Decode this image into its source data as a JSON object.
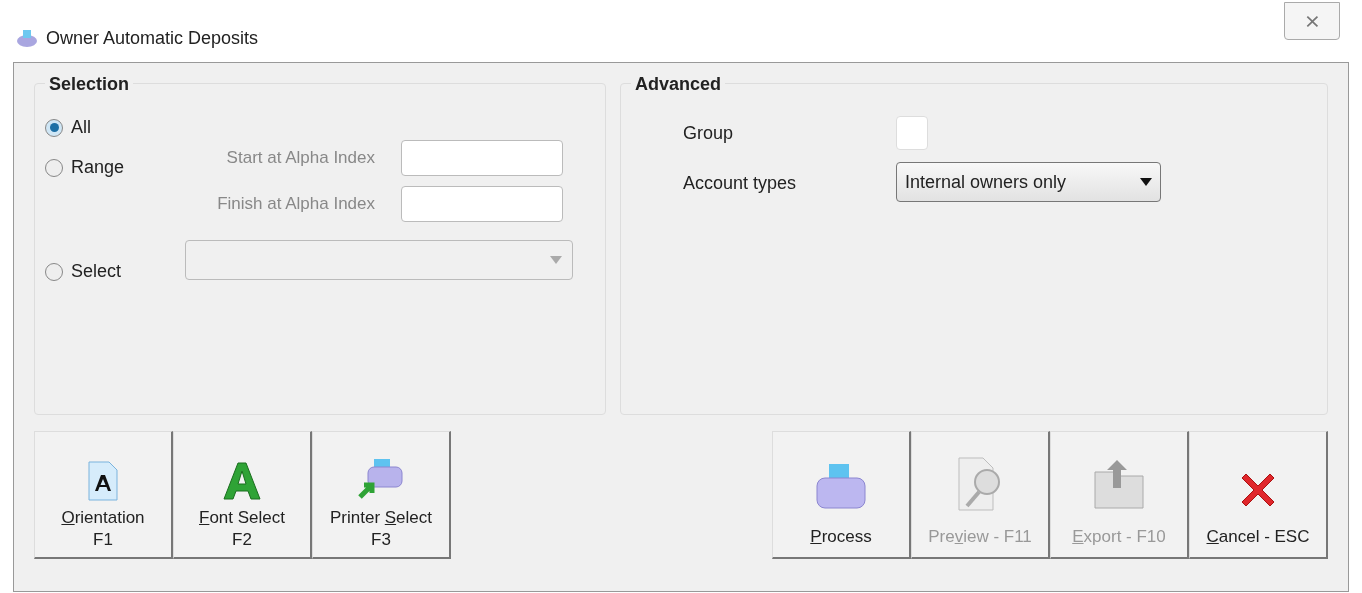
{
  "window": {
    "title": "Owner Automatic Deposits",
    "close": "⨯"
  },
  "selection": {
    "title": "Selection",
    "options": [
      {
        "label": "All",
        "selected": true
      },
      {
        "label": "Range",
        "selected": false
      },
      {
        "label": "Select",
        "selected": false
      }
    ],
    "range_fields": [
      {
        "label": "Start at Alpha Index",
        "disabled": true
      },
      {
        "label": "Finish at Alpha Index",
        "disabled": true
      }
    ],
    "select_dropdown": {
      "disabled": true
    }
  },
  "advanced": {
    "title": "Advanced",
    "group": {
      "label": "Group",
      "checked": false
    },
    "account_types": {
      "label": "Account types",
      "value": "Internal owners only"
    }
  },
  "left_buttons": [
    {
      "kind": "orientation",
      "key": "O",
      "post": "rientation",
      "line2": "F1",
      "disabled": false
    },
    {
      "kind": "font",
      "key": "F",
      "post": "ont Select",
      "line2": "F2",
      "disabled": false
    },
    {
      "kind": "printer-select",
      "pre": "Printer ",
      "key": "S",
      "post": "elect",
      "line2": "F3",
      "disabled": false
    }
  ],
  "right_buttons": [
    {
      "kind": "process",
      "key": "P",
      "post": "rocess",
      "disabled": false
    },
    {
      "kind": "preview",
      "pre": "Pre",
      "key": "v",
      "post": "iew - F11",
      "disabled": true
    },
    {
      "kind": "export",
      "key": "E",
      "post": "xport - F10",
      "disabled": true
    },
    {
      "kind": "cancel",
      "key": "C",
      "post": "ancel - ESC",
      "disabled": false
    }
  ]
}
